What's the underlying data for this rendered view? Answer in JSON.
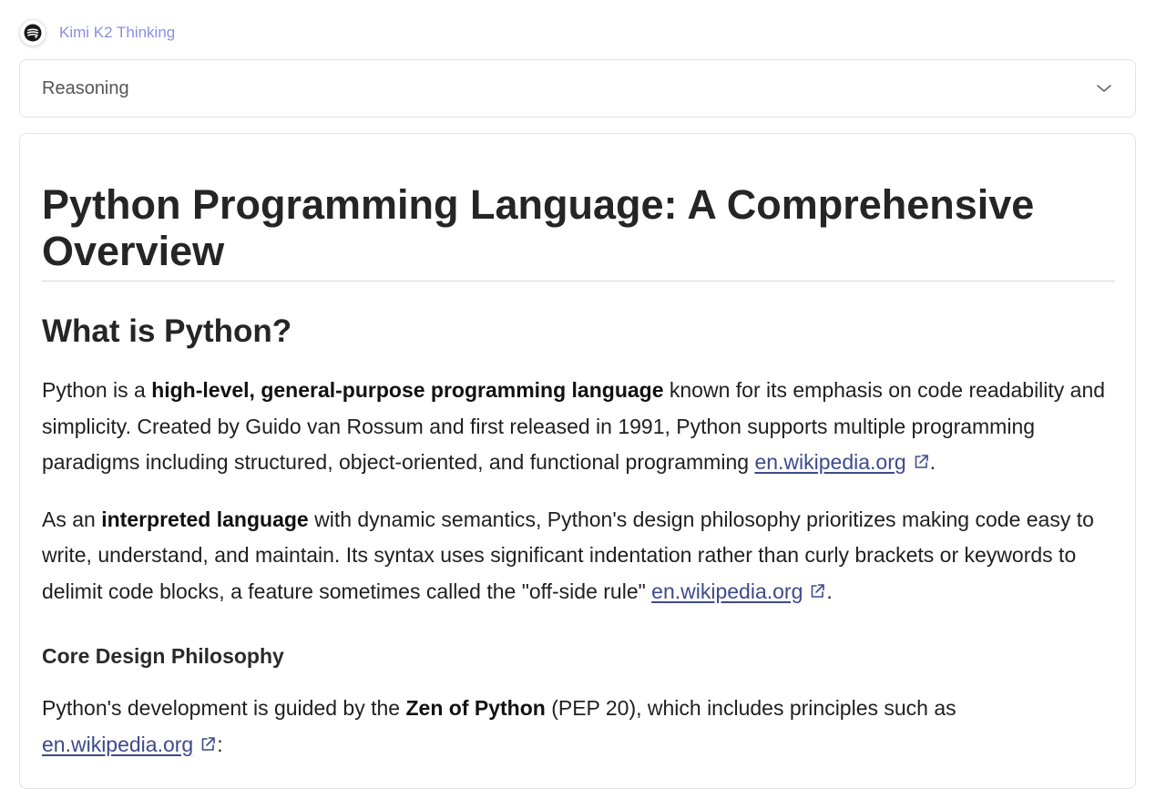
{
  "header": {
    "model_name": "Kimi K2 Thinking",
    "avatar_icon": "kimi-logo-icon"
  },
  "reasoning": {
    "label": "Reasoning",
    "toggle_icon": "chevron-down-icon"
  },
  "article": {
    "title": "Python Programming Language: A Comprehensive Overview",
    "section_heading": "What is Python?",
    "p1": {
      "t1": "Python is a ",
      "b1": "high-level, general-purpose programming language",
      "t2": " known for its emphasis on code readability and simplicity. Created by Guido van Rossum and first released in 1991, Python supports multiple programming paradigms including structured, object-oriented, and functional programming ",
      "link": "en.wikipedia.org",
      "end": "."
    },
    "p2": {
      "t1": "As an ",
      "b1": "interpreted language",
      "t2": " with dynamic semantics, Python's design philosophy prioritizes making code easy to write, understand, and maintain. Its syntax uses significant indentation rather than curly brackets or keywords to delimit code blocks, a feature sometimes called the \"off-side rule\" ",
      "link": "en.wikipedia.org",
      "end": "."
    },
    "subheading": "Core Design Philosophy",
    "p3": {
      "t1": "Python's development is guided by the ",
      "b1": "Zen of Python",
      "t2": " (PEP 20), which includes principles such as ",
      "link": "en.wikipedia.org",
      "end": ":"
    }
  },
  "colors": {
    "model_name": "#8a8ee0",
    "link": "#3e4a8a"
  }
}
